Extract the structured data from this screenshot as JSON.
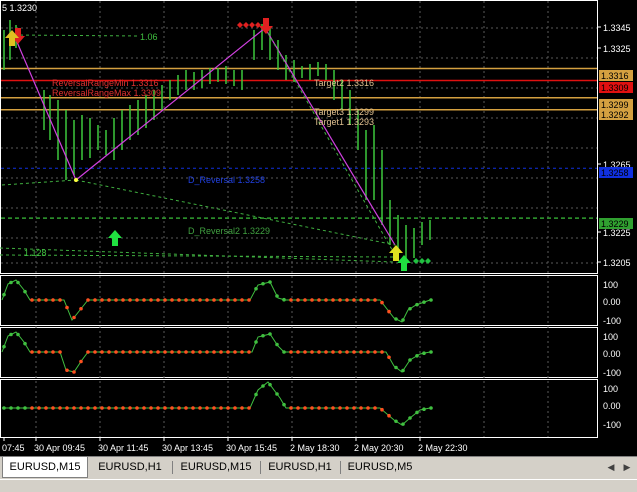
{
  "chart": {
    "title_price": "5 1.3230",
    "fib_label_top": "1.06",
    "fib_label_bottom": "1.128",
    "price_ticks": [
      "1.3345",
      "1.3325",
      "1.3265",
      "1.3225",
      "1.3205"
    ],
    "price_badges": [
      {
        "text": "1.3316",
        "color": "#d4a040"
      },
      {
        "text": "1.3309",
        "color": "#e01010"
      },
      {
        "text": "1.3299",
        "color": "#d4a040"
      },
      {
        "text": "1.3292",
        "color": "#d4a040"
      },
      {
        "text": "1.3258",
        "color": "#1030e0"
      },
      {
        "text": "1.3229",
        "color": "#30a030"
      }
    ],
    "line_labels": [
      {
        "text": "ReversalRangeMin 1.3316",
        "color": "#e03030"
      },
      {
        "text": "ReversalRangeMax 1.3309",
        "color": "#e03030"
      },
      {
        "text": "Target2 1.3316",
        "color": "#e0c090"
      },
      {
        "text": "Target3 1.3299",
        "color": "#e0c090"
      },
      {
        "text": "Target1 1.3293",
        "color": "#e0c090"
      },
      {
        "text": "D_Reversal 1.3258",
        "color": "#2040e0"
      },
      {
        "text": "D_Reversal2 1.3229",
        "color": "#40a040"
      }
    ],
    "indicator_ticks": [
      "100",
      "0.00",
      "-100"
    ],
    "time_labels": [
      "07:45",
      "30 Apr 09:45",
      "30 Apr 11:45",
      "30 Apr 13:45",
      "30 Apr 15:45",
      "2 May 18:30",
      "2 May 20:30",
      "2 May 22:30"
    ]
  },
  "chart_data": {
    "type": "line",
    "title": "5 1.3230",
    "x": [
      "07:45",
      "30 Apr 09:45",
      "30 Apr 11:45",
      "30 Apr 13:45",
      "30 Apr 15:45",
      "2 May 18:30",
      "2 May 20:30",
      "2 May 22:30"
    ],
    "zigzag": [
      {
        "x": "07:45",
        "y": 1.334
      },
      {
        "x": "30 Apr 09:45",
        "y": 1.3265
      },
      {
        "x": "30 Apr 15:45",
        "y": 1.3345
      },
      {
        "x": "2 May 22:30",
        "y": 1.3208
      }
    ],
    "horizontal_levels": [
      1.3316,
      1.3309,
      1.3299,
      1.3292,
      1.3258,
      1.3229
    ],
    "ylim": [
      1.32,
      1.335
    ],
    "indicator_levels": [
      100,
      0,
      -100
    ]
  },
  "tabs": [
    {
      "label": "EURUSD,M15",
      "active": true
    },
    {
      "label": "EURUSD,H1",
      "active": false
    },
    {
      "label": "EURUSD,M15",
      "active": false
    },
    {
      "label": "EURUSD,H1",
      "active": false
    },
    {
      "label": "EURUSD,M5",
      "active": false
    }
  ]
}
